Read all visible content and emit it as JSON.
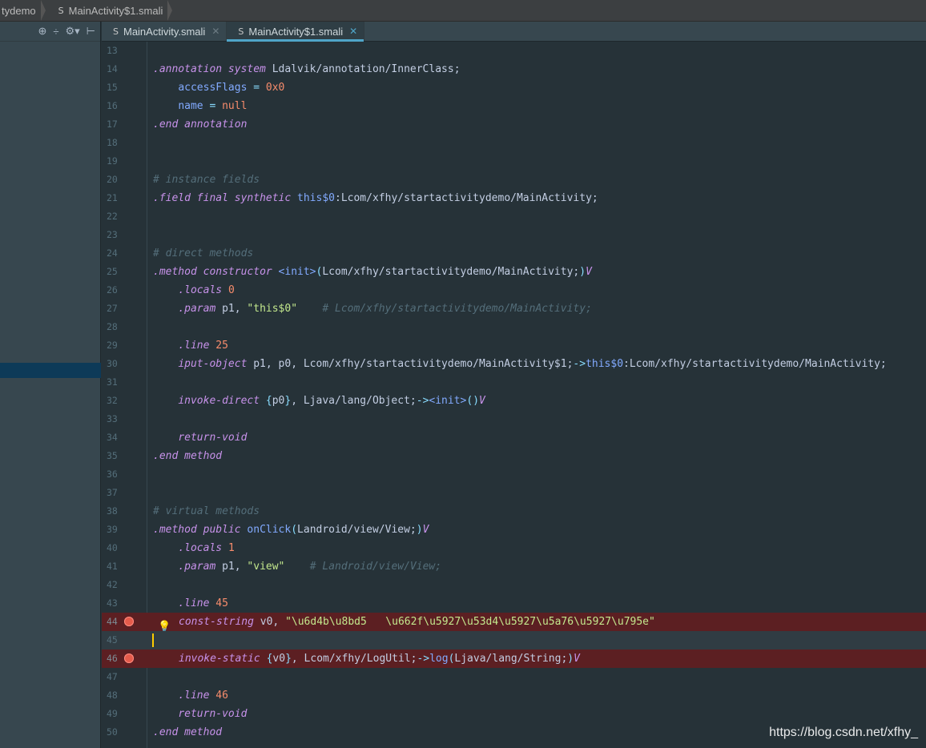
{
  "breadcrumbs": [
    "tydemo",
    "MainActivity$1.smali"
  ],
  "tabs": [
    {
      "label": "MainActivity.smali",
      "active": false
    },
    {
      "label": "MainActivity$1.smali",
      "active": true
    }
  ],
  "editor": {
    "lines": [
      {
        "n": "13",
        "segs": []
      },
      {
        "n": "14",
        "segs": [
          [
            "dir",
            ".annotation"
          ],
          [
            "t",
            " "
          ],
          [
            "kw",
            "system"
          ],
          [
            "t",
            " "
          ],
          [
            "typ",
            "Ldalvik/annotation/InnerClass;"
          ]
        ]
      },
      {
        "n": "15",
        "segs": [
          [
            "t",
            "    "
          ],
          [
            "fld",
            "accessFlags"
          ],
          [
            "t",
            " "
          ],
          [
            "op",
            "="
          ],
          [
            "t",
            " "
          ],
          [
            "num",
            "0x0"
          ]
        ]
      },
      {
        "n": "16",
        "segs": [
          [
            "t",
            "    "
          ],
          [
            "fld",
            "name"
          ],
          [
            "t",
            " "
          ],
          [
            "op",
            "="
          ],
          [
            "t",
            " "
          ],
          [
            "num",
            "null"
          ]
        ]
      },
      {
        "n": "17",
        "segs": [
          [
            "dir",
            ".end"
          ],
          [
            "t",
            " "
          ],
          [
            "kw",
            "annotation"
          ]
        ]
      },
      {
        "n": "18",
        "segs": []
      },
      {
        "n": "19",
        "segs": []
      },
      {
        "n": "20",
        "segs": [
          [
            "cmt",
            "# instance fields"
          ]
        ]
      },
      {
        "n": "21",
        "segs": [
          [
            "dir",
            ".field"
          ],
          [
            "t",
            " "
          ],
          [
            "kw",
            "final synthetic"
          ],
          [
            "t",
            " "
          ],
          [
            "fld",
            "this$0"
          ],
          [
            "typ",
            ":Lcom/xfhy/startactivitydemo/MainActivity;"
          ]
        ]
      },
      {
        "n": "22",
        "segs": []
      },
      {
        "n": "23",
        "segs": []
      },
      {
        "n": "24",
        "segs": [
          [
            "cmt",
            "# direct methods"
          ]
        ]
      },
      {
        "n": "25",
        "segs": [
          [
            "dir",
            ".method"
          ],
          [
            "t",
            " "
          ],
          [
            "kw",
            "constructor"
          ],
          [
            "t",
            " "
          ],
          [
            "fld",
            "<init>"
          ],
          [
            "op",
            "("
          ],
          [
            "typ",
            "Lcom/xfhy/startactivitydemo/MainActivity;"
          ],
          [
            "op",
            ")"
          ],
          [
            "kw",
            "V"
          ]
        ]
      },
      {
        "n": "26",
        "segs": [
          [
            "t",
            "    "
          ],
          [
            "dir",
            ".locals"
          ],
          [
            "t",
            " "
          ],
          [
            "num",
            "0"
          ]
        ]
      },
      {
        "n": "27",
        "segs": [
          [
            "t",
            "    "
          ],
          [
            "dir",
            ".param"
          ],
          [
            "t",
            " "
          ],
          [
            "typ",
            "p1,"
          ],
          [
            "t",
            " "
          ],
          [
            "str",
            "\"this$0\""
          ],
          [
            "t",
            "    "
          ],
          [
            "cmt",
            "# Lcom/xfhy/startactivitydemo/MainActivity;"
          ]
        ]
      },
      {
        "n": "28",
        "segs": []
      },
      {
        "n": "29",
        "segs": [
          [
            "t",
            "    "
          ],
          [
            "dir",
            ".line"
          ],
          [
            "t",
            " "
          ],
          [
            "num",
            "25"
          ]
        ]
      },
      {
        "n": "30",
        "segs": [
          [
            "t",
            "    "
          ],
          [
            "kw",
            "iput-object"
          ],
          [
            "t",
            " "
          ],
          [
            "typ",
            "p1, p0, Lcom/xfhy/startactivitydemo/MainActivity$1;"
          ],
          [
            "op",
            "->"
          ],
          [
            "fld",
            "this$0"
          ],
          [
            "typ",
            ":Lcom/xfhy/startactivitydemo/MainActivity;"
          ]
        ]
      },
      {
        "n": "31",
        "segs": []
      },
      {
        "n": "32",
        "segs": [
          [
            "t",
            "    "
          ],
          [
            "kw",
            "invoke-direct"
          ],
          [
            "t",
            " "
          ],
          [
            "op",
            "{"
          ],
          [
            "typ",
            "p0"
          ],
          [
            "op",
            "}"
          ],
          [
            "typ",
            ", Ljava/lang/Object;"
          ],
          [
            "op",
            "->"
          ],
          [
            "fld",
            "<init>"
          ],
          [
            "op",
            "()"
          ],
          [
            "kw",
            "V"
          ]
        ]
      },
      {
        "n": "33",
        "segs": []
      },
      {
        "n": "34",
        "segs": [
          [
            "t",
            "    "
          ],
          [
            "kw",
            "return-void"
          ]
        ]
      },
      {
        "n": "35",
        "segs": [
          [
            "dir",
            ".end"
          ],
          [
            "t",
            " "
          ],
          [
            "kw",
            "method"
          ]
        ]
      },
      {
        "n": "36",
        "segs": []
      },
      {
        "n": "37",
        "segs": []
      },
      {
        "n": "38",
        "segs": [
          [
            "cmt",
            "# virtual methods"
          ]
        ]
      },
      {
        "n": "39",
        "segs": [
          [
            "dir",
            ".method"
          ],
          [
            "t",
            " "
          ],
          [
            "kw",
            "public"
          ],
          [
            "t",
            " "
          ],
          [
            "fld",
            "onClick"
          ],
          [
            "op",
            "("
          ],
          [
            "typ",
            "Landroid/view/View;"
          ],
          [
            "op",
            ")"
          ],
          [
            "kw",
            "V"
          ]
        ]
      },
      {
        "n": "40",
        "segs": [
          [
            "t",
            "    "
          ],
          [
            "dir",
            ".locals"
          ],
          [
            "t",
            " "
          ],
          [
            "num",
            "1"
          ]
        ]
      },
      {
        "n": "41",
        "segs": [
          [
            "t",
            "    "
          ],
          [
            "dir",
            ".param"
          ],
          [
            "t",
            " "
          ],
          [
            "typ",
            "p1,"
          ],
          [
            "t",
            " "
          ],
          [
            "str",
            "\"view\""
          ],
          [
            "t",
            "    "
          ],
          [
            "cmt",
            "# Landroid/view/View;"
          ]
        ]
      },
      {
        "n": "42",
        "segs": []
      },
      {
        "n": "43",
        "segs": [
          [
            "t",
            "    "
          ],
          [
            "dir",
            ".line"
          ],
          [
            "t",
            " "
          ],
          [
            "num",
            "45"
          ]
        ]
      },
      {
        "n": "44",
        "breakpoint": true,
        "bulb": true,
        "segs": [
          [
            "kw",
            "const-string"
          ],
          [
            "t",
            " "
          ],
          [
            "typ",
            "v0,"
          ],
          [
            "t",
            " "
          ],
          [
            "str",
            "\"\\u6d4b\\u8bd5   \\u662f\\u5927\\u53d4\\u5927\\u5a76\\u5927\\u795e\""
          ]
        ]
      },
      {
        "n": "45",
        "caret": true,
        "segs": []
      },
      {
        "n": "46",
        "breakpoint": true,
        "segs": [
          [
            "kw",
            "invoke-static"
          ],
          [
            "t",
            " "
          ],
          [
            "op",
            "{"
          ],
          [
            "typ",
            "v0"
          ],
          [
            "op",
            "}"
          ],
          [
            "typ",
            ", Lcom/xfhy/LogUtil;"
          ],
          [
            "op",
            "->"
          ],
          [
            "fld",
            "log"
          ],
          [
            "op",
            "("
          ],
          [
            "typ",
            "Ljava/lang/String;"
          ],
          [
            "op",
            ")"
          ],
          [
            "kw",
            "V"
          ]
        ]
      },
      {
        "n": "47",
        "segs": []
      },
      {
        "n": "48",
        "segs": [
          [
            "t",
            "    "
          ],
          [
            "dir",
            ".line"
          ],
          [
            "t",
            " "
          ],
          [
            "num",
            "46"
          ]
        ]
      },
      {
        "n": "49",
        "segs": [
          [
            "t",
            "    "
          ],
          [
            "kw",
            "return-void"
          ]
        ]
      },
      {
        "n": "50",
        "segs": [
          [
            "dir",
            ".end"
          ],
          [
            "t",
            " "
          ],
          [
            "kw",
            "method"
          ]
        ]
      }
    ]
  },
  "watermark": "https://blog.csdn.net/xfhy_",
  "colors": {
    "background": "#263238",
    "breakpoint_line": "#5c1f22",
    "accent": "#4fa5c8",
    "caret": "#ffcc00"
  }
}
